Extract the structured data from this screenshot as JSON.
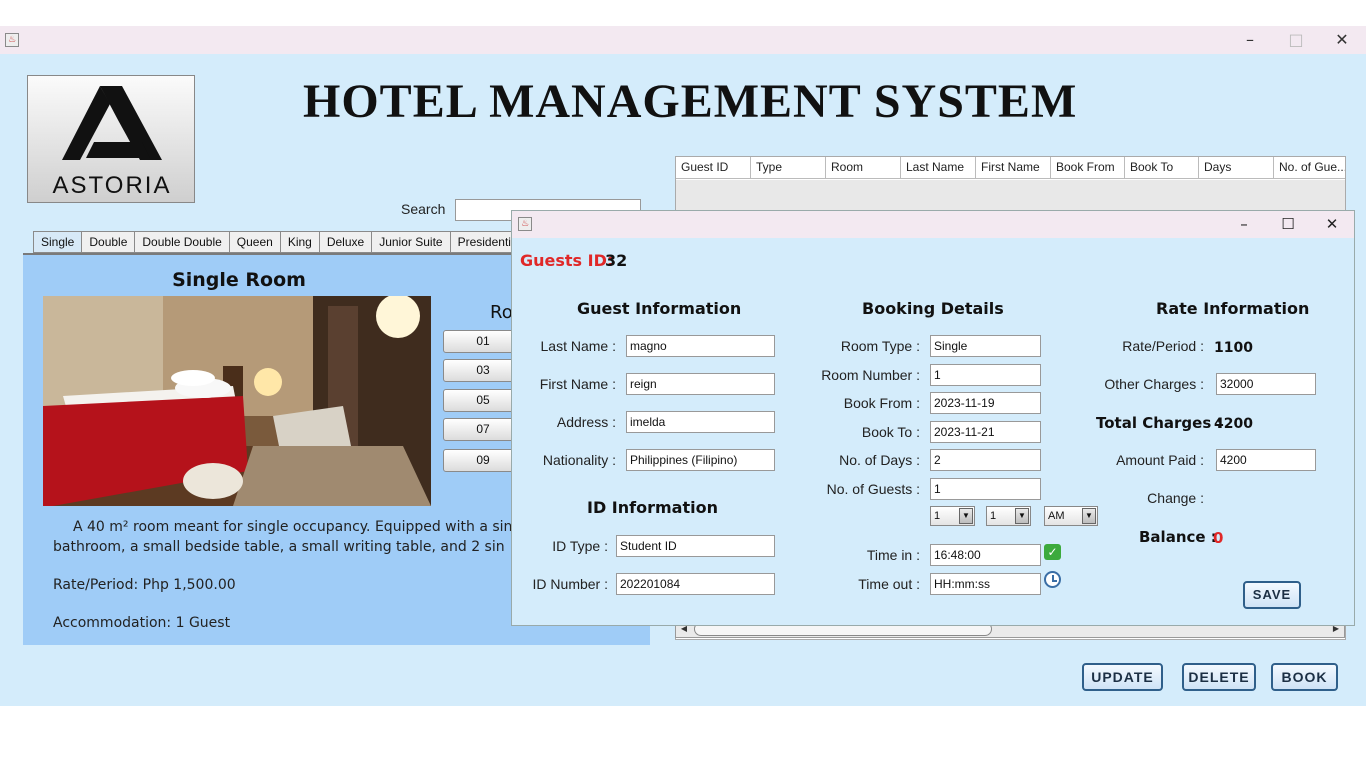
{
  "main": {
    "title": "HOTEL MANAGEMENT SYSTEM",
    "logo_text": "ASTORIA",
    "search_label": "Search",
    "search_value": "",
    "tabs": [
      {
        "label": "Single"
      },
      {
        "label": "Double"
      },
      {
        "label": "Double Double"
      },
      {
        "label": "Queen"
      },
      {
        "label": "King"
      },
      {
        "label": "Deluxe"
      },
      {
        "label": "Junior Suite"
      },
      {
        "label": "Presidential"
      }
    ],
    "room": {
      "title": "Single Room",
      "rooms_label": "Ro",
      "room_buttons": [
        "01",
        "03",
        "05",
        "07",
        "09"
      ],
      "description": "A 40 m² room meant for single occupancy. Equipped with a single siz attached bathroom, a small bedside table, a small writing table, and 2 sin",
      "rate": "Rate/Period: Php 1,500.00",
      "accommodation": "Accommodation: 1 Guest"
    },
    "table": {
      "columns": [
        "Guest ID",
        "Type",
        "Room",
        "Last Name",
        "First Name",
        "Book From",
        "Book To",
        "Days",
        "No. of Gue..."
      ]
    },
    "buttons": {
      "update": "UPDATE",
      "delete": "DELETE",
      "book": "BOOK"
    },
    "window_controls": {
      "minimize": "–",
      "maximize": "□",
      "close": "✕"
    }
  },
  "dialog": {
    "guest_id_label": "Guests ID:",
    "guest_id_value": "32",
    "window_controls": {
      "minimize": "–",
      "maximize": "☐",
      "close": "✕"
    },
    "guest_info": {
      "title": "Guest Information",
      "last_name_label": "Last Name :",
      "last_name": "magno",
      "first_name_label": "First Name :",
      "first_name": "reign",
      "address_label": "Address :",
      "address": "imelda",
      "nationality_label": "Nationality :",
      "nationality": "Philippines (Filipino)"
    },
    "id_info": {
      "title": "ID Information",
      "id_type_label": "ID Type :",
      "id_type": "Student ID",
      "id_number_label": "ID Number :",
      "id_number": "202201084"
    },
    "booking": {
      "title": "Booking Details",
      "room_type_label": "Room Type :",
      "room_type": "Single",
      "room_number_label": "Room Number :",
      "room_number": "1",
      "book_from_label": "Book From :",
      "book_from": "2023-11-19",
      "book_to_label": "Book To :",
      "book_to": "2023-11-21",
      "days_label": "No. of Days :",
      "days": "2",
      "guests_label": "No. of Guests :",
      "guests": "1",
      "hour": "1",
      "minute": "1",
      "ampm": "AM",
      "time_in_label": "Time in :",
      "time_in": "16:48:00",
      "time_out_label": "Time out :",
      "time_out": "HH:mm:ss"
    },
    "rate": {
      "title": "Rate Information",
      "rate_period_label": "Rate/Period :",
      "rate_period": "1100",
      "other_charges_label": "Other Charges :",
      "other_charges": "32000",
      "total_charges_label": "Total Charges :",
      "total_charges": "4200",
      "amount_paid_label": "Amount Paid :",
      "amount_paid": "4200",
      "change_label": "Change :",
      "balance_label": "Balance :",
      "balance": "0"
    },
    "save_label": "SAVE"
  }
}
